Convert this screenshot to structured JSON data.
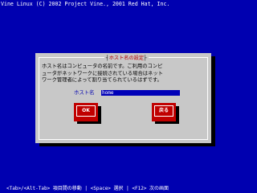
{
  "header": {
    "copyright": "Vine Linux (C) 2002 Project Vine., 2001 Red Hat, Inc."
  },
  "dialog": {
    "title": "ホスト名の設定",
    "description_lines": [
      "ホスト名はコンピュータの名前です。ご利用のコンピ",
      "ュータがネットワークに接続されている場合はネット",
      "ワーク管理者によって割り当てられているはずです。"
    ],
    "hostname_label": "ホスト名",
    "hostname_value": "home",
    "ok_label": "OK",
    "back_label": "戻る"
  },
  "footer": {
    "hint": "<Tab>/<Alt-Tab> 項目間の移動 | <Space> 選択 | <F12> 次の画面"
  },
  "colors": {
    "background": "#0000b0",
    "dialog": "#c8c8c8",
    "button": "#c00000",
    "input": "#0000b8"
  }
}
